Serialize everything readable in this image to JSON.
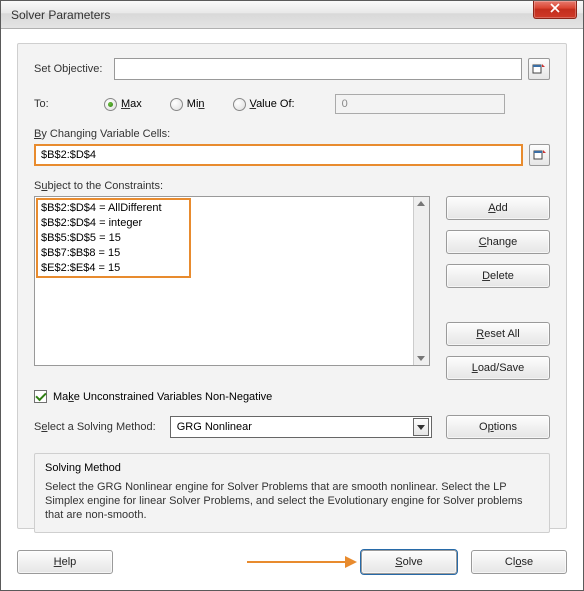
{
  "window": {
    "title": "Solver Parameters"
  },
  "objective": {
    "label": "Set Objective:",
    "value": ""
  },
  "to": {
    "label": "To:",
    "max": "Max",
    "min": "Min",
    "valueOf": "Value Of:",
    "valueOfInput": "0",
    "selected": "max"
  },
  "changing": {
    "label": "By Changing Variable Cells:",
    "value": "$B$2:$D$4"
  },
  "constraints": {
    "label": "Subject to the Constraints:",
    "items": [
      "$B$2:$D$4 = AllDifferent",
      "$B$2:$D$4 = integer",
      "$B$5:$D$5 = 15",
      "$B$7:$B$8 = 15",
      "$E$2:$E$4 = 15"
    ]
  },
  "buttons": {
    "add": "Add",
    "change": "Change",
    "delete": "Delete",
    "resetAll": "Reset All",
    "loadSave": "Load/Save",
    "options": "Options",
    "help": "Help",
    "solve": "Solve",
    "close": "Close"
  },
  "nonneg": {
    "label": "Make Unconstrained Variables Non-Negative",
    "checked": true
  },
  "method": {
    "label": "Select a Solving Method:",
    "value": "GRG Nonlinear"
  },
  "desc": {
    "head": "Solving Method",
    "body": "Select the GRG Nonlinear engine for Solver Problems that are smooth nonlinear. Select the LP Simplex engine for linear Solver Problems, and select the Evolutionary engine for Solver problems that are non-smooth."
  }
}
